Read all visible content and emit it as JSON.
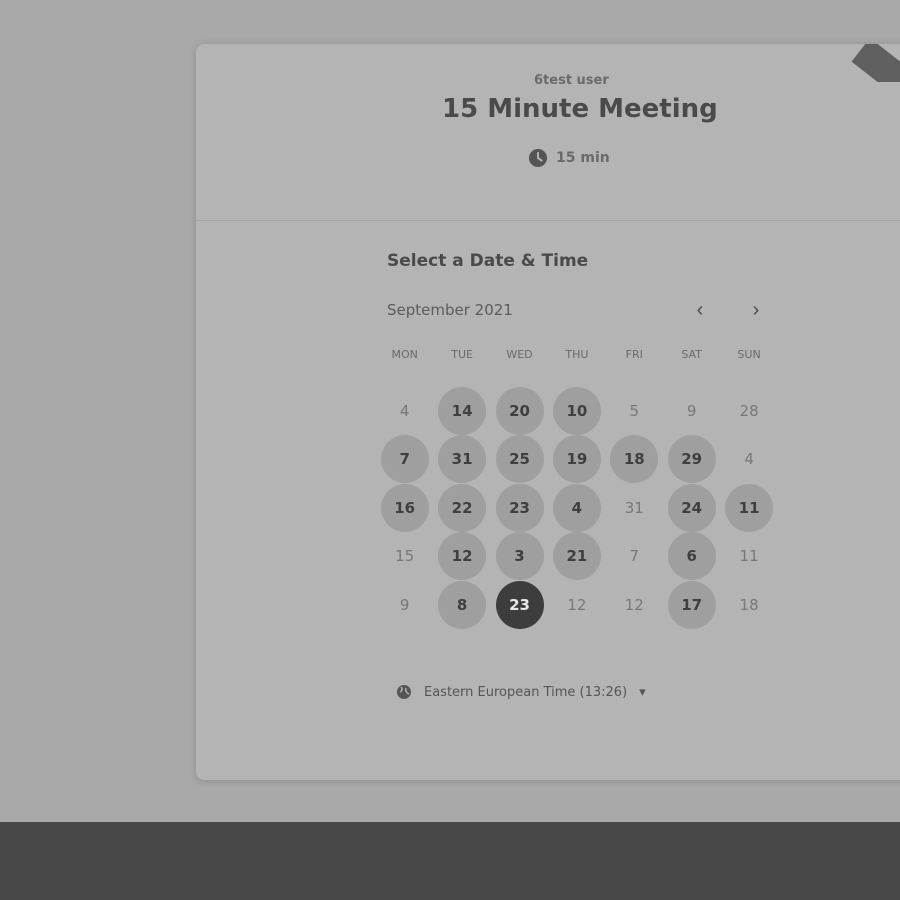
{
  "event": {
    "organizer": "6test user",
    "title": "15 Minute Meeting",
    "duration": "15 min"
  },
  "picker": {
    "heading": "Select a Date & Time",
    "month": "September 2021",
    "weekdays": [
      "MON",
      "TUE",
      "WED",
      "THU",
      "FRI",
      "SAT",
      "SUN"
    ],
    "rows": [
      [
        {
          "d": "4",
          "s": "off"
        },
        {
          "d": "14",
          "s": "avail"
        },
        {
          "d": "20",
          "s": "avail"
        },
        {
          "d": "10",
          "s": "avail"
        },
        {
          "d": "5",
          "s": "off"
        },
        {
          "d": "9",
          "s": "off"
        },
        {
          "d": "28",
          "s": "off"
        }
      ],
      [
        {
          "d": "7",
          "s": "avail"
        },
        {
          "d": "31",
          "s": "avail"
        },
        {
          "d": "25",
          "s": "avail"
        },
        {
          "d": "19",
          "s": "avail"
        },
        {
          "d": "18",
          "s": "avail"
        },
        {
          "d": "29",
          "s": "avail"
        },
        {
          "d": "4",
          "s": "off"
        }
      ],
      [
        {
          "d": "16",
          "s": "avail"
        },
        {
          "d": "22",
          "s": "avail"
        },
        {
          "d": "23",
          "s": "avail"
        },
        {
          "d": "4",
          "s": "avail"
        },
        {
          "d": "31",
          "s": "off"
        },
        {
          "d": "24",
          "s": "avail"
        },
        {
          "d": "11",
          "s": "avail"
        }
      ],
      [
        {
          "d": "15",
          "s": "off"
        },
        {
          "d": "12",
          "s": "avail"
        },
        {
          "d": "3",
          "s": "avail"
        },
        {
          "d": "21",
          "s": "avail"
        },
        {
          "d": "7",
          "s": "off"
        },
        {
          "d": "6",
          "s": "avail"
        },
        {
          "d": "11",
          "s": "off"
        }
      ],
      [
        {
          "d": "9",
          "s": "off"
        },
        {
          "d": "8",
          "s": "avail"
        },
        {
          "d": "23",
          "s": "selected"
        },
        {
          "d": "12",
          "s": "off"
        },
        {
          "d": "12",
          "s": "off"
        },
        {
          "d": "17",
          "s": "avail"
        },
        {
          "d": "18",
          "s": "off"
        }
      ]
    ],
    "timezone": "Eastern European Time (13:26)",
    "timezone_caret": "▾",
    "prev_label": "‹",
    "next_label": "›"
  },
  "icons": {
    "clock": "clock-icon",
    "globe": "globe-icon",
    "ribbon": "ribbon"
  }
}
